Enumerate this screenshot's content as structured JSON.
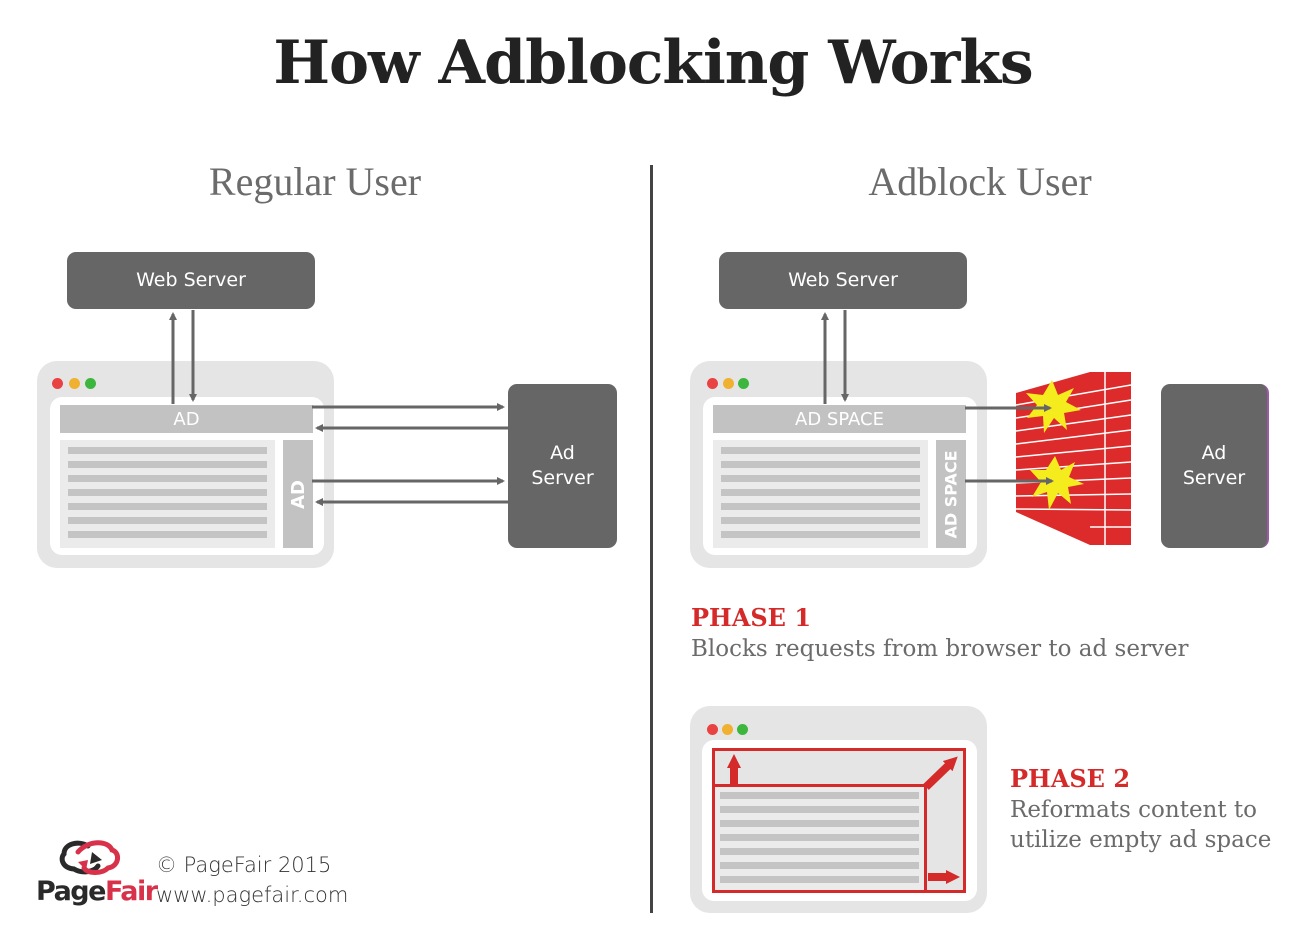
{
  "title": "How Adblocking Works",
  "regular": {
    "heading": "Regular User",
    "web_server": "Web Server",
    "ad_server_line1": "Ad",
    "ad_server_line2": "Server",
    "top_ad": "AD",
    "side_ad": "AD"
  },
  "adblock": {
    "heading": "Adblock User",
    "web_server": "Web Server",
    "ad_server_line1": "Ad",
    "ad_server_line2": "Server",
    "top_ad": "AD SPACE",
    "side_ad": "AD SPACE",
    "phase1": {
      "title": "PHASE 1",
      "description": "Blocks requests from browser to ad server"
    },
    "phase2": {
      "title": "PHASE 2",
      "description_line1": "Reformats content to",
      "description_line2": "utilize empty ad space"
    }
  },
  "footer": {
    "logo_part1": "Page",
    "logo_part2": "Fair",
    "copyright": "© PageFair 2015",
    "url": "www.pagefair.com"
  },
  "colors": {
    "accent_red": "#d42a2a",
    "server_gray": "#666666",
    "ad_gray": "#c2c2c2",
    "browser_gray": "#e5e5e5",
    "firewall_red": "#dd2b2b",
    "explosion_yellow": "#f5ec1e",
    "dot_red": "#e84242",
    "dot_yellow": "#f0b030",
    "dot_green": "#3cb63c"
  }
}
